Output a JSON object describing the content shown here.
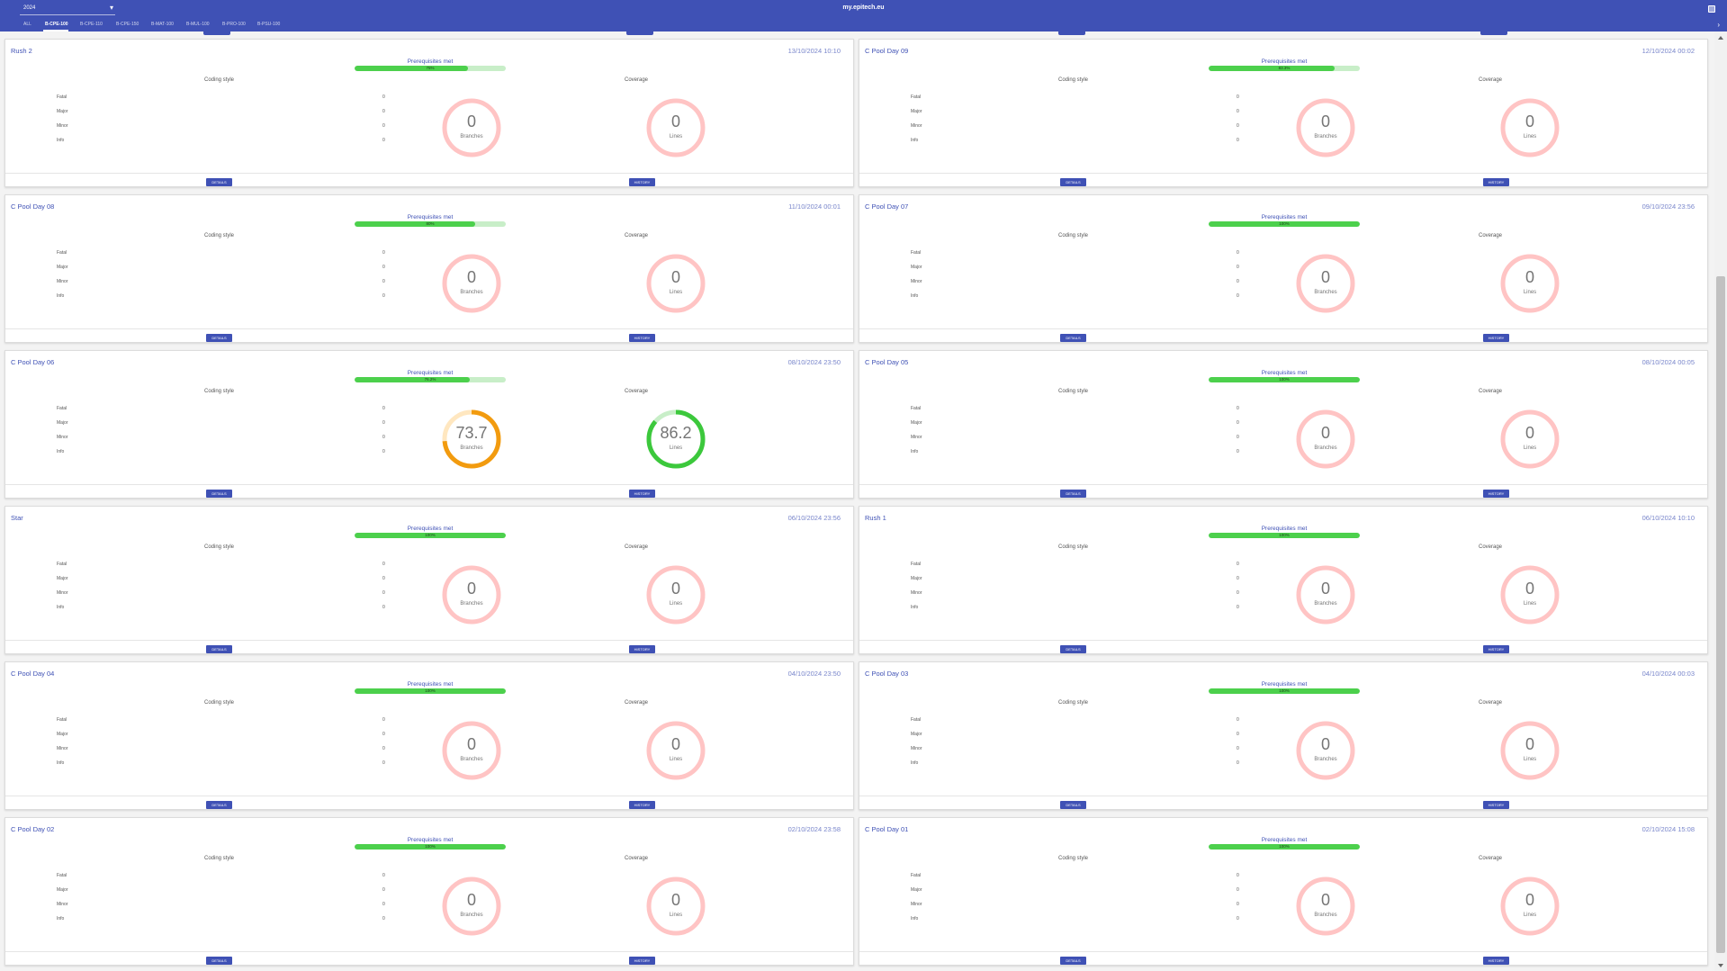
{
  "header": {
    "year": "2024",
    "site": "my.epitech.eu"
  },
  "tabs": [
    {
      "label": "ALL",
      "active": false
    },
    {
      "label": "B-CPE-100",
      "active": true
    },
    {
      "label": "B-CPE-110",
      "active": false
    },
    {
      "label": "B-CPE-150",
      "active": false
    },
    {
      "label": "B-MAT-100",
      "active": false
    },
    {
      "label": "B-MUL-100",
      "active": false
    },
    {
      "label": "B-PRO-100",
      "active": false
    },
    {
      "label": "B-PSU-100",
      "active": false
    }
  ],
  "labels": {
    "prerequisites": "Prerequisites met",
    "coding_style": "Coding style",
    "coverage": "Coverage",
    "fatal": "Fatal",
    "major": "Major",
    "minor": "Minor",
    "info": "Info",
    "branches": "Branches",
    "lines": "Lines",
    "details": "DETAILS",
    "history": "HISTORY"
  },
  "colors": {
    "primary": "#3f51b5",
    "prereq_fill": "#4cd04c",
    "prereq_track": "#c8eec8",
    "zero_ring": "#ffc4c4",
    "branches_ring": "#f29b0f",
    "branches_track": "#ffe7c0",
    "lines_ring": "#3cc83c",
    "lines_track": "#c8eec8"
  },
  "projects": [
    {
      "title": "Rush 2",
      "date": "13/10/2024 10:10",
      "prereq": 75,
      "prereq_label": "75%",
      "fatal": 0,
      "major": 0,
      "minor": 0,
      "info": 0,
      "branches": 0,
      "branches_label": "0",
      "lines": 0,
      "lines_label": "0"
    },
    {
      "title": "C Pool Day 09",
      "date": "12/10/2024 00:02",
      "prereq": 83.3,
      "prereq_label": "83.3%",
      "fatal": 0,
      "major": 0,
      "minor": 0,
      "info": 0,
      "branches": 0,
      "branches_label": "0",
      "lines": 0,
      "lines_label": "0"
    },
    {
      "title": "C Pool Day 08",
      "date": "11/10/2024 00:01",
      "prereq": 80,
      "prereq_label": "80%",
      "fatal": 0,
      "major": 0,
      "minor": 0,
      "info": 0,
      "branches": 0,
      "branches_label": "0",
      "lines": 0,
      "lines_label": "0"
    },
    {
      "title": "C Pool Day 07",
      "date": "09/10/2024 23:56",
      "prereq": 100,
      "prereq_label": "100%",
      "fatal": 0,
      "major": 0,
      "minor": 0,
      "info": 0,
      "branches": 0,
      "branches_label": "0",
      "lines": 0,
      "lines_label": "0"
    },
    {
      "title": "C Pool Day 06",
      "date": "08/10/2024 23:50",
      "prereq": 76.2,
      "prereq_label": "76.2%",
      "fatal": 0,
      "major": 0,
      "minor": 0,
      "info": 0,
      "branches": 73.7,
      "branches_label": "73.7",
      "lines": 86.2,
      "lines_label": "86.2"
    },
    {
      "title": "C Pool Day 05",
      "date": "08/10/2024 00:05",
      "prereq": 100,
      "prereq_label": "100%",
      "fatal": 0,
      "major": 0,
      "minor": 0,
      "info": 0,
      "branches": 0,
      "branches_label": "0",
      "lines": 0,
      "lines_label": "0"
    },
    {
      "title": "Star",
      "date": "06/10/2024 23:56",
      "prereq": 100,
      "prereq_label": "100%",
      "fatal": 0,
      "major": 0,
      "minor": 0,
      "info": 0,
      "branches": 0,
      "branches_label": "0",
      "lines": 0,
      "lines_label": "0"
    },
    {
      "title": "Rush 1",
      "date": "06/10/2024 10:10",
      "prereq": 100,
      "prereq_label": "100%",
      "fatal": 0,
      "major": 0,
      "minor": 0,
      "info": 0,
      "branches": 0,
      "branches_label": "0",
      "lines": 0,
      "lines_label": "0"
    },
    {
      "title": "C Pool Day 04",
      "date": "04/10/2024 23:50",
      "prereq": 100,
      "prereq_label": "100%",
      "fatal": 0,
      "major": 0,
      "minor": 0,
      "info": 0,
      "branches": 0,
      "branches_label": "0",
      "lines": 0,
      "lines_label": "0"
    },
    {
      "title": "C Pool Day 03",
      "date": "04/10/2024 00:03",
      "prereq": 100,
      "prereq_label": "100%",
      "fatal": 0,
      "major": 0,
      "minor": 0,
      "info": 0,
      "branches": 0,
      "branches_label": "0",
      "lines": 0,
      "lines_label": "0"
    },
    {
      "title": "C Pool Day 02",
      "date": "02/10/2024 23:58",
      "prereq": 100,
      "prereq_label": "100%",
      "fatal": 0,
      "major": 0,
      "minor": 0,
      "info": 0,
      "branches": 0,
      "branches_label": "0",
      "lines": 0,
      "lines_label": "0"
    },
    {
      "title": "C Pool Day 01",
      "date": "02/10/2024 15:08",
      "prereq": 100,
      "prereq_label": "100%",
      "fatal": 0,
      "major": 0,
      "minor": 0,
      "info": 0,
      "branches": 0,
      "branches_label": "0",
      "lines": 0,
      "lines_label": "0"
    }
  ]
}
